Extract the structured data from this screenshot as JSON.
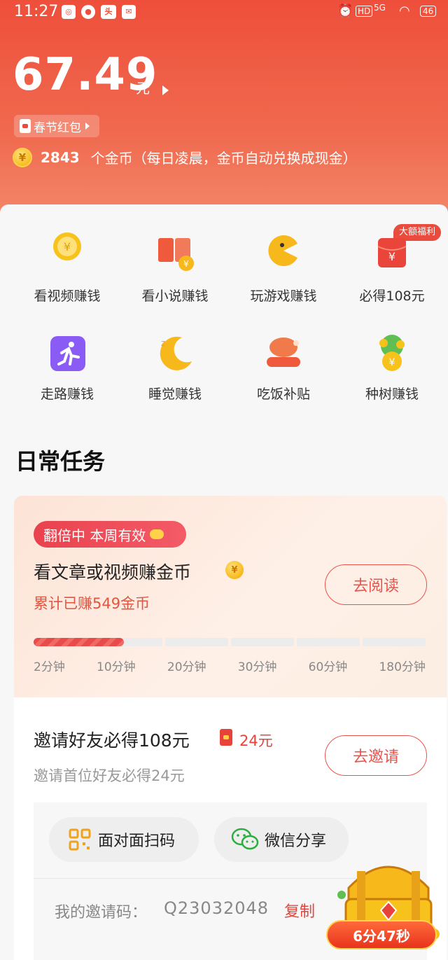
{
  "status_bar": {
    "time": "11:27",
    "battery": "46",
    "network": "5G",
    "hd": "HD"
  },
  "wallet": {
    "balance": "67.49",
    "unit": "元",
    "spring_pill": "春节红包",
    "coin_count": "2843",
    "coin_text": "个金币（每日凌晨，金币自动兑换成现金）",
    "coin_symbol": "¥"
  },
  "grid": {
    "badge": "大额福利",
    "items": [
      {
        "label": "看视频赚钱",
        "icon": "coin-video-icon",
        "color": "#f7c21c"
      },
      {
        "label": "看小说赚钱",
        "icon": "book-icon",
        "color": "#ef5a3d"
      },
      {
        "label": "玩游戏赚钱",
        "icon": "pacman-icon",
        "color": "#f7b81c"
      },
      {
        "label": "必得108元",
        "icon": "red-envelope-icon",
        "color": "#e9453b"
      },
      {
        "label": "走路赚钱",
        "icon": "run-icon",
        "color": "#8a5cf5"
      },
      {
        "label": "睡觉赚钱",
        "icon": "moon-icon",
        "color": "#f7b81c"
      },
      {
        "label": "吃饭补贴",
        "icon": "chicken-icon",
        "color": "#f07a4a"
      },
      {
        "label": "种树赚钱",
        "icon": "coin-tree-icon",
        "color": "#5fbf52"
      }
    ]
  },
  "daily": {
    "section_title": "日常任务",
    "double_pill": "翻倍中 本周有效",
    "task_title": "看文章或视频赚金币",
    "task_sub": "累计已赚549金币",
    "read_button": "去阅读",
    "progress_fraction": 0.23,
    "ticks": [
      "2分钟",
      "10分钟",
      "20分钟",
      "30分钟",
      "60分钟",
      "180分钟"
    ]
  },
  "invite": {
    "title": "邀请好友必得108元",
    "amount": "24元",
    "sub": "邀请首位好友必得24元",
    "button": "去邀请",
    "scan": "面对面扫码",
    "wechat": "微信分享",
    "code_label": "我的邀请码：",
    "code_value": "Q23032048",
    "copy": "复制"
  },
  "chest": {
    "timer": "6分47秒"
  }
}
